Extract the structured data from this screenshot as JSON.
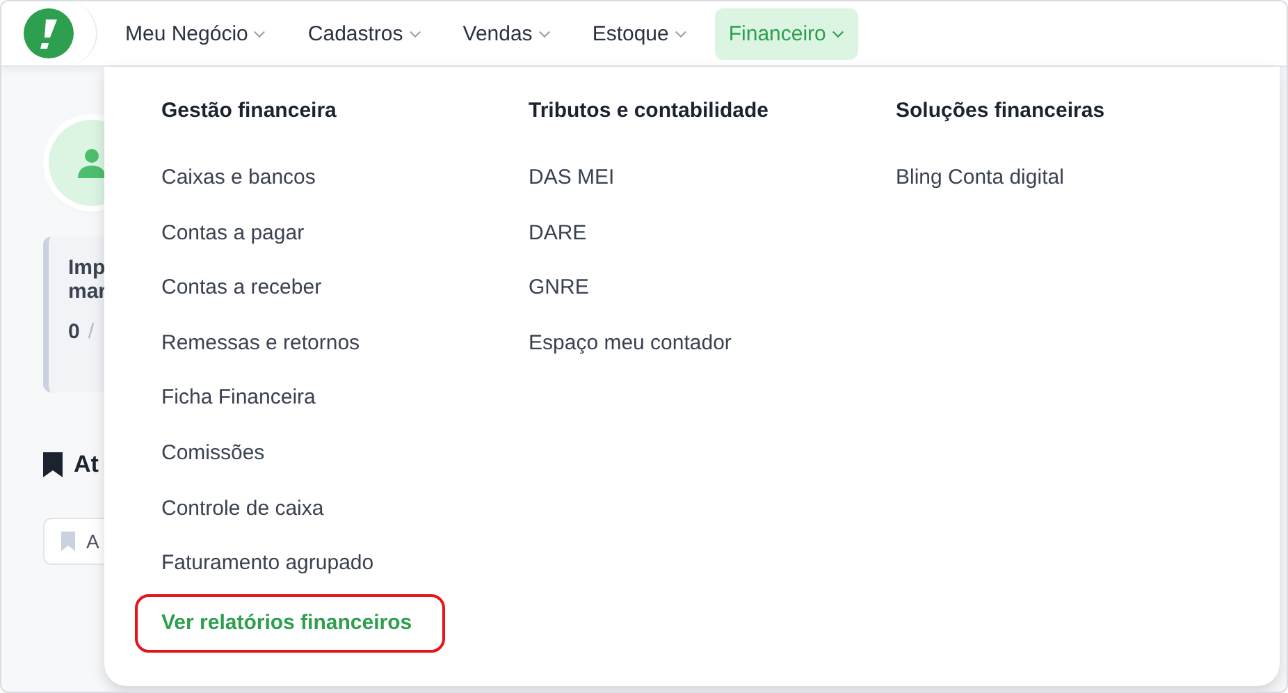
{
  "nav": {
    "items": [
      {
        "label": "Meu Negócio",
        "selected": false
      },
      {
        "label": "Cadastros",
        "selected": false
      },
      {
        "label": "Vendas",
        "selected": false
      },
      {
        "label": "Estoque",
        "selected": false
      },
      {
        "label": "Financeiro",
        "selected": true
      }
    ]
  },
  "background": {
    "card": {
      "title_lines": [
        "Imp",
        "mar"
      ],
      "count": "0",
      "separator": "/"
    },
    "section_title": "At",
    "chip": "A"
  },
  "menu": {
    "columns": [
      {
        "title": "Gestão financeira",
        "items": [
          {
            "label": "Caixas e bancos",
            "highlighted": false
          },
          {
            "label": "Contas a pagar",
            "highlighted": false
          },
          {
            "label": "Contas a receber",
            "highlighted": false
          },
          {
            "label": "Remessas e retornos",
            "highlighted": false
          },
          {
            "label": "Ficha Financeira",
            "highlighted": false
          },
          {
            "label": "Comissões",
            "highlighted": false
          },
          {
            "label": "Controle de caixa",
            "highlighted": false
          },
          {
            "label": "Faturamento agrupado",
            "highlighted": false
          },
          {
            "label": "Ver relatórios financeiros",
            "highlighted": true
          }
        ]
      },
      {
        "title": "Tributos e contabilidade",
        "items": [
          {
            "label": "DAS MEI",
            "highlighted": false
          },
          {
            "label": "DARE",
            "highlighted": false
          },
          {
            "label": "GNRE",
            "highlighted": false
          },
          {
            "label": "Espaço meu contador",
            "highlighted": false
          }
        ]
      },
      {
        "title": "Soluções financeiras",
        "items": [
          {
            "label": "Bling Conta digital",
            "highlighted": false
          }
        ]
      }
    ]
  }
}
